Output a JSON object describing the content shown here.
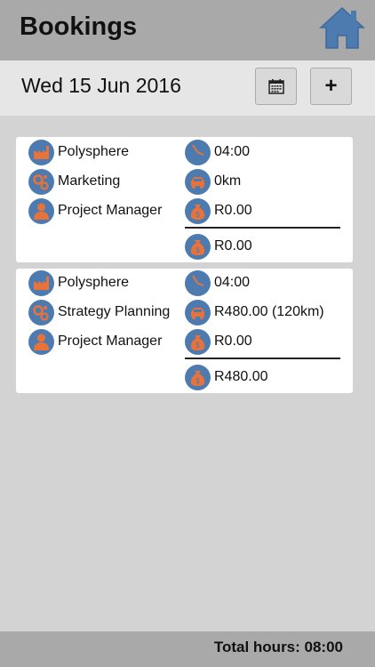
{
  "header": {
    "title": "Bookings"
  },
  "datebar": {
    "date": "Wed 15 Jun 2016",
    "add_label": "+"
  },
  "bookings": [
    {
      "client": "Polysphere",
      "activity": "Marketing",
      "role": "Project Manager",
      "duration": "04:00",
      "travel": "0km",
      "expense": "R0.00",
      "total": "R0.00"
    },
    {
      "client": "Polysphere",
      "activity": "Strategy Planning",
      "role": "Project Manager",
      "duration": "04:00",
      "travel": "R480.00 (120km)",
      "expense": "R0.00",
      "total": "R480.00"
    }
  ],
  "footer": {
    "total_hours": "Total hours: 08:00"
  },
  "colors": {
    "icon_bg": "#4d7bb0",
    "icon_accent": "#e8733a",
    "header_bg": "#a9a9a9"
  },
  "icons": [
    "home-icon",
    "calendar-icon",
    "factory-icon",
    "gears-icon",
    "person-icon",
    "clock-icon",
    "car-icon",
    "money-bag-icon"
  ]
}
